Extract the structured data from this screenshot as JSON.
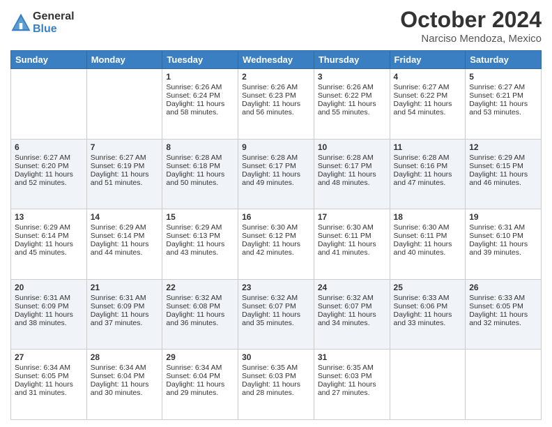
{
  "logo": {
    "general": "General",
    "blue": "Blue"
  },
  "title": "October 2024",
  "subtitle": "Narciso Mendoza, Mexico",
  "days_of_week": [
    "Sunday",
    "Monday",
    "Tuesday",
    "Wednesday",
    "Thursday",
    "Friday",
    "Saturday"
  ],
  "weeks": [
    [
      {
        "day": "",
        "sunrise": "",
        "sunset": "",
        "daylight": "",
        "empty": true
      },
      {
        "day": "",
        "sunrise": "",
        "sunset": "",
        "daylight": "",
        "empty": true
      },
      {
        "day": "1",
        "sunrise": "Sunrise: 6:26 AM",
        "sunset": "Sunset: 6:24 PM",
        "daylight": "Daylight: 11 hours and 58 minutes."
      },
      {
        "day": "2",
        "sunrise": "Sunrise: 6:26 AM",
        "sunset": "Sunset: 6:23 PM",
        "daylight": "Daylight: 11 hours and 56 minutes."
      },
      {
        "day": "3",
        "sunrise": "Sunrise: 6:26 AM",
        "sunset": "Sunset: 6:22 PM",
        "daylight": "Daylight: 11 hours and 55 minutes."
      },
      {
        "day": "4",
        "sunrise": "Sunrise: 6:27 AM",
        "sunset": "Sunset: 6:22 PM",
        "daylight": "Daylight: 11 hours and 54 minutes."
      },
      {
        "day": "5",
        "sunrise": "Sunrise: 6:27 AM",
        "sunset": "Sunset: 6:21 PM",
        "daylight": "Daylight: 11 hours and 53 minutes."
      }
    ],
    [
      {
        "day": "6",
        "sunrise": "Sunrise: 6:27 AM",
        "sunset": "Sunset: 6:20 PM",
        "daylight": "Daylight: 11 hours and 52 minutes."
      },
      {
        "day": "7",
        "sunrise": "Sunrise: 6:27 AM",
        "sunset": "Sunset: 6:19 PM",
        "daylight": "Daylight: 11 hours and 51 minutes."
      },
      {
        "day": "8",
        "sunrise": "Sunrise: 6:28 AM",
        "sunset": "Sunset: 6:18 PM",
        "daylight": "Daylight: 11 hours and 50 minutes."
      },
      {
        "day": "9",
        "sunrise": "Sunrise: 6:28 AM",
        "sunset": "Sunset: 6:17 PM",
        "daylight": "Daylight: 11 hours and 49 minutes."
      },
      {
        "day": "10",
        "sunrise": "Sunrise: 6:28 AM",
        "sunset": "Sunset: 6:17 PM",
        "daylight": "Daylight: 11 hours and 48 minutes."
      },
      {
        "day": "11",
        "sunrise": "Sunrise: 6:28 AM",
        "sunset": "Sunset: 6:16 PM",
        "daylight": "Daylight: 11 hours and 47 minutes."
      },
      {
        "day": "12",
        "sunrise": "Sunrise: 6:29 AM",
        "sunset": "Sunset: 6:15 PM",
        "daylight": "Daylight: 11 hours and 46 minutes."
      }
    ],
    [
      {
        "day": "13",
        "sunrise": "Sunrise: 6:29 AM",
        "sunset": "Sunset: 6:14 PM",
        "daylight": "Daylight: 11 hours and 45 minutes."
      },
      {
        "day": "14",
        "sunrise": "Sunrise: 6:29 AM",
        "sunset": "Sunset: 6:14 PM",
        "daylight": "Daylight: 11 hours and 44 minutes."
      },
      {
        "day": "15",
        "sunrise": "Sunrise: 6:29 AM",
        "sunset": "Sunset: 6:13 PM",
        "daylight": "Daylight: 11 hours and 43 minutes."
      },
      {
        "day": "16",
        "sunrise": "Sunrise: 6:30 AM",
        "sunset": "Sunset: 6:12 PM",
        "daylight": "Daylight: 11 hours and 42 minutes."
      },
      {
        "day": "17",
        "sunrise": "Sunrise: 6:30 AM",
        "sunset": "Sunset: 6:11 PM",
        "daylight": "Daylight: 11 hours and 41 minutes."
      },
      {
        "day": "18",
        "sunrise": "Sunrise: 6:30 AM",
        "sunset": "Sunset: 6:11 PM",
        "daylight": "Daylight: 11 hours and 40 minutes."
      },
      {
        "day": "19",
        "sunrise": "Sunrise: 6:31 AM",
        "sunset": "Sunset: 6:10 PM",
        "daylight": "Daylight: 11 hours and 39 minutes."
      }
    ],
    [
      {
        "day": "20",
        "sunrise": "Sunrise: 6:31 AM",
        "sunset": "Sunset: 6:09 PM",
        "daylight": "Daylight: 11 hours and 38 minutes."
      },
      {
        "day": "21",
        "sunrise": "Sunrise: 6:31 AM",
        "sunset": "Sunset: 6:09 PM",
        "daylight": "Daylight: 11 hours and 37 minutes."
      },
      {
        "day": "22",
        "sunrise": "Sunrise: 6:32 AM",
        "sunset": "Sunset: 6:08 PM",
        "daylight": "Daylight: 11 hours and 36 minutes."
      },
      {
        "day": "23",
        "sunrise": "Sunrise: 6:32 AM",
        "sunset": "Sunset: 6:07 PM",
        "daylight": "Daylight: 11 hours and 35 minutes."
      },
      {
        "day": "24",
        "sunrise": "Sunrise: 6:32 AM",
        "sunset": "Sunset: 6:07 PM",
        "daylight": "Daylight: 11 hours and 34 minutes."
      },
      {
        "day": "25",
        "sunrise": "Sunrise: 6:33 AM",
        "sunset": "Sunset: 6:06 PM",
        "daylight": "Daylight: 11 hours and 33 minutes."
      },
      {
        "day": "26",
        "sunrise": "Sunrise: 6:33 AM",
        "sunset": "Sunset: 6:05 PM",
        "daylight": "Daylight: 11 hours and 32 minutes."
      }
    ],
    [
      {
        "day": "27",
        "sunrise": "Sunrise: 6:34 AM",
        "sunset": "Sunset: 6:05 PM",
        "daylight": "Daylight: 11 hours and 31 minutes."
      },
      {
        "day": "28",
        "sunrise": "Sunrise: 6:34 AM",
        "sunset": "Sunset: 6:04 PM",
        "daylight": "Daylight: 11 hours and 30 minutes."
      },
      {
        "day": "29",
        "sunrise": "Sunrise: 6:34 AM",
        "sunset": "Sunset: 6:04 PM",
        "daylight": "Daylight: 11 hours and 29 minutes."
      },
      {
        "day": "30",
        "sunrise": "Sunrise: 6:35 AM",
        "sunset": "Sunset: 6:03 PM",
        "daylight": "Daylight: 11 hours and 28 minutes."
      },
      {
        "day": "31",
        "sunrise": "Sunrise: 6:35 AM",
        "sunset": "Sunset: 6:03 PM",
        "daylight": "Daylight: 11 hours and 27 minutes."
      },
      {
        "day": "",
        "sunrise": "",
        "sunset": "",
        "daylight": "",
        "empty": true
      },
      {
        "day": "",
        "sunrise": "",
        "sunset": "",
        "daylight": "",
        "empty": true
      }
    ]
  ]
}
